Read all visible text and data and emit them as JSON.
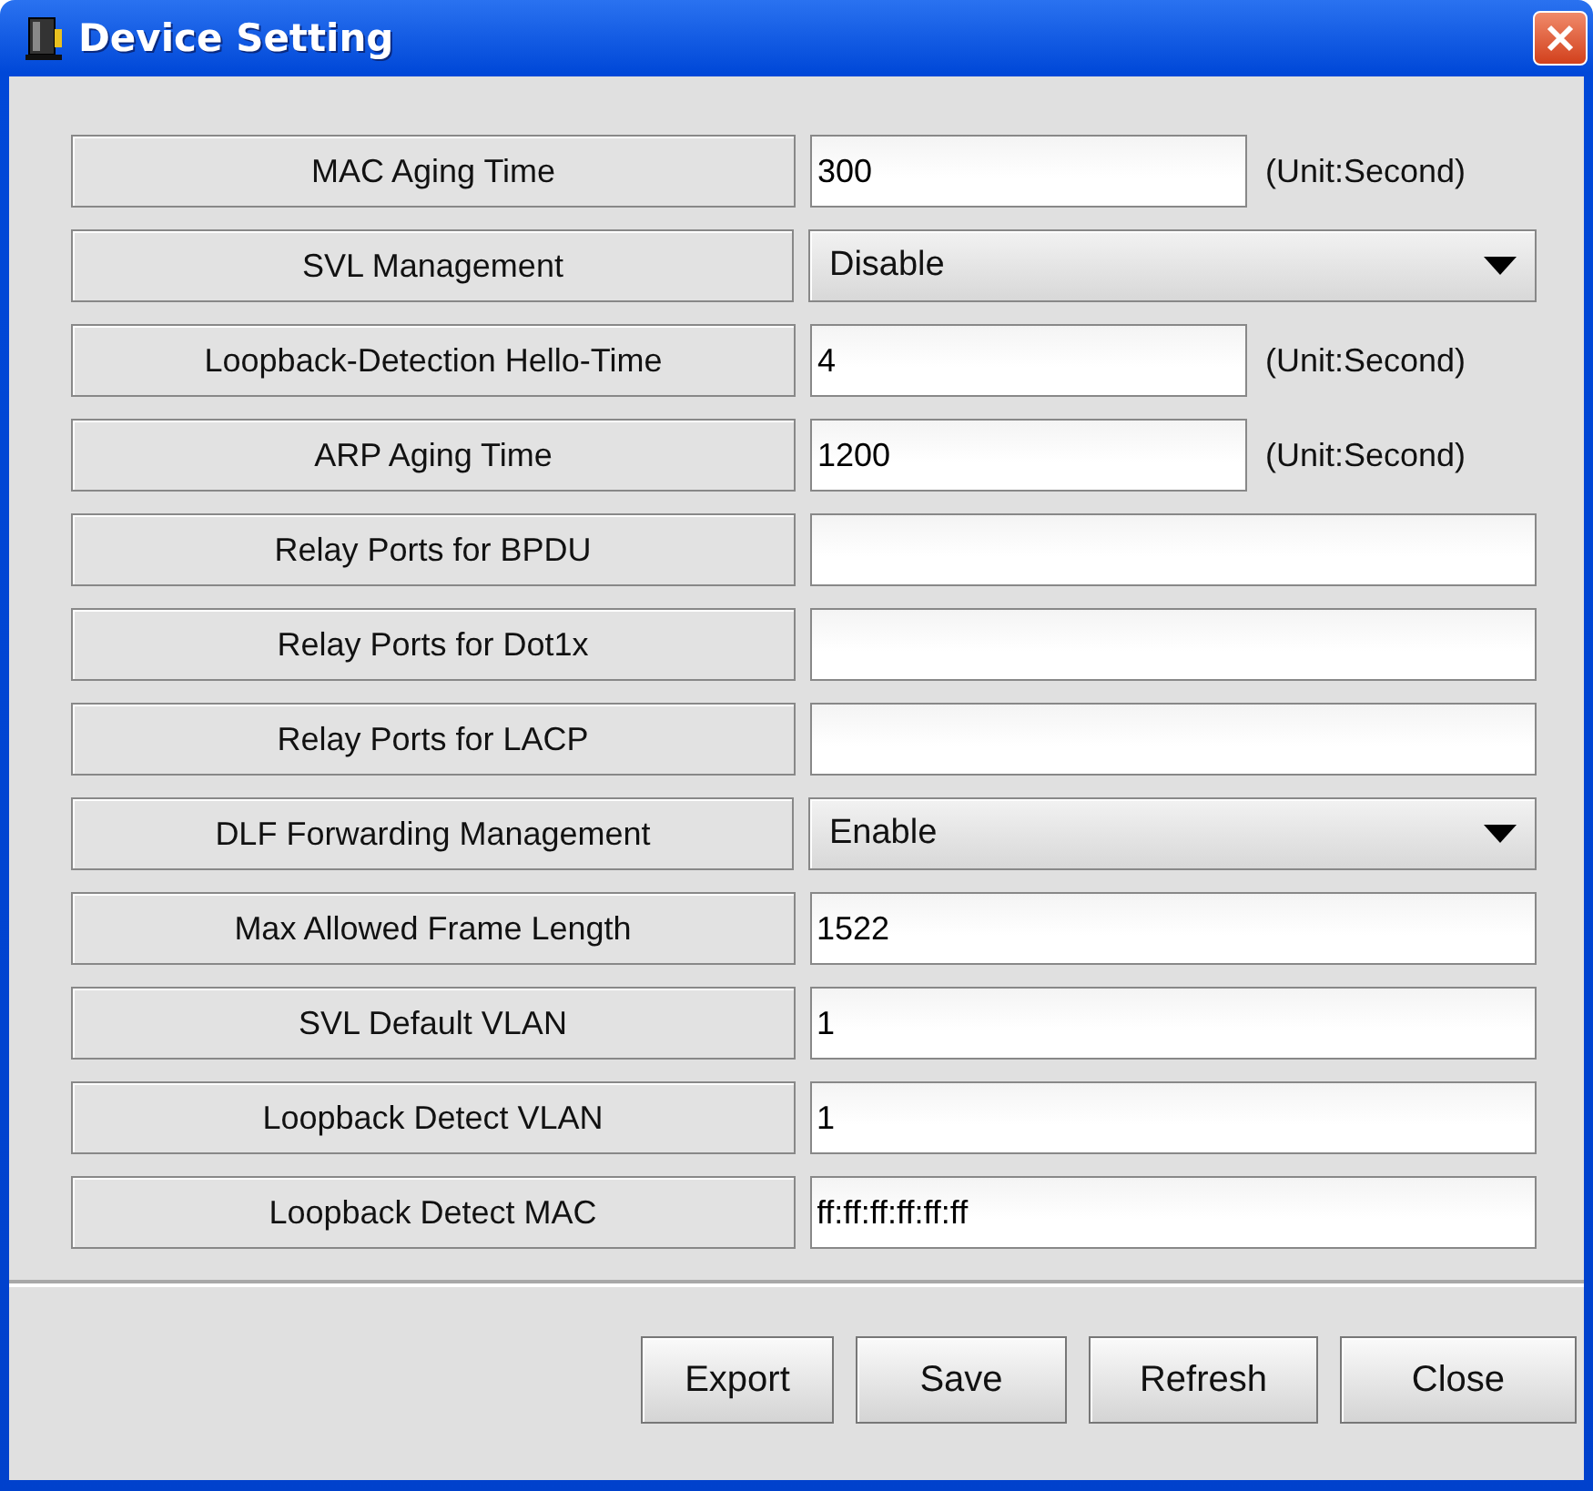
{
  "window": {
    "title": "Device Setting"
  },
  "rows": [
    {
      "kind": "text",
      "label": "MAC Aging Time",
      "value": "300",
      "unit": "(Unit:Second)"
    },
    {
      "kind": "select",
      "label": "SVL Management",
      "value": "Disable"
    },
    {
      "kind": "text",
      "label": "Loopback-Detection Hello-Time",
      "value": "4",
      "unit": "(Unit:Second)"
    },
    {
      "kind": "text",
      "label": "ARP Aging Time",
      "value": "1200",
      "unit": "(Unit:Second)"
    },
    {
      "kind": "text",
      "label": "Relay Ports for BPDU"
    },
    {
      "kind": "text",
      "label": "Relay Ports for Dot1x"
    },
    {
      "kind": "text",
      "label": "Relay Ports for LACP"
    },
    {
      "kind": "select",
      "label": "DLF Forwarding Management",
      "value": "Enable"
    },
    {
      "kind": "text",
      "label": "Max Allowed Frame Length",
      "value": "1522"
    },
    {
      "kind": "text",
      "label": "SVL Default VLAN",
      "value": "1"
    },
    {
      "kind": "text",
      "label": "Loopback Detect VLAN",
      "value": "1"
    },
    {
      "kind": "text",
      "label": "Loopback Detect MAC",
      "value": "ff:ff:ff:ff:ff:ff"
    }
  ],
  "buttons": [
    "Export",
    "Save",
    "Refresh",
    "Close"
  ]
}
